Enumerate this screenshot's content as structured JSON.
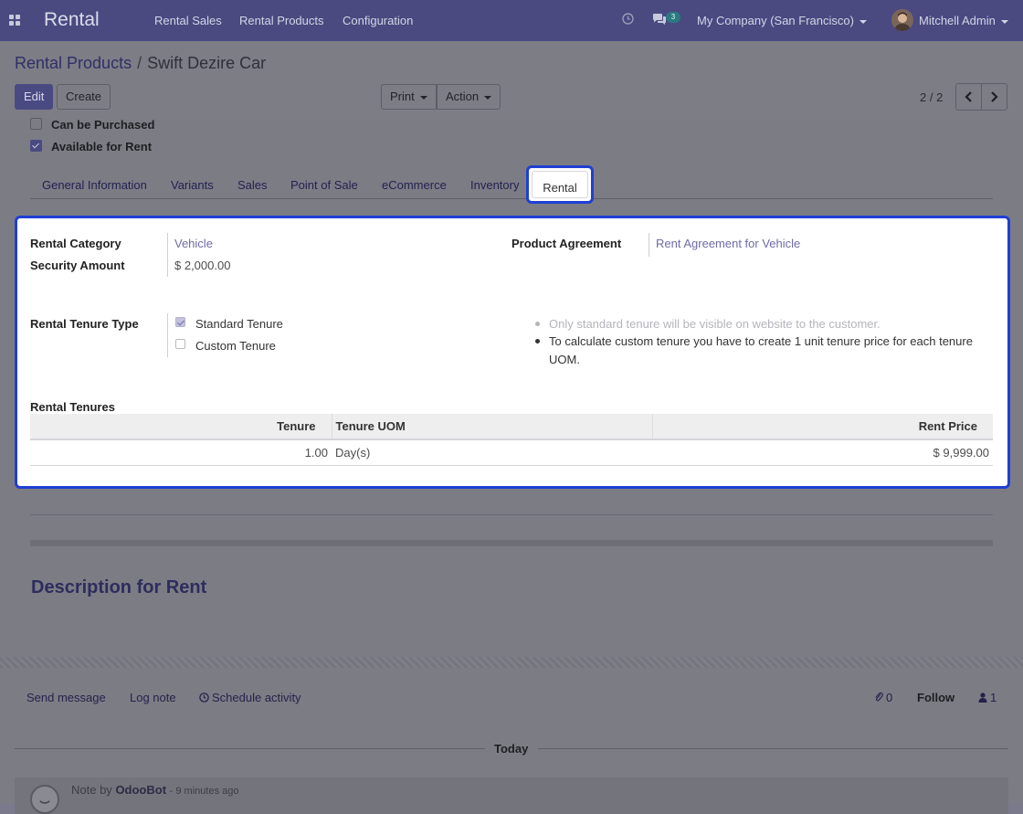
{
  "navbar": {
    "app_name": "Rental",
    "menu": [
      "Rental Sales",
      "Rental Products",
      "Configuration"
    ],
    "messages_count": "3",
    "company": "My Company (San Francisco)",
    "user": "Mitchell Admin"
  },
  "breadcrumb": {
    "parent": "Rental Products",
    "separator": "/",
    "current": "Swift Dezire Car"
  },
  "toolbar": {
    "edit_label": "Edit",
    "create_label": "Create",
    "print_label": "Print",
    "action_label": "Action"
  },
  "pager": {
    "value": "2 / 2"
  },
  "form": {
    "options": [
      {
        "label": "Can be Purchased",
        "checked": false
      },
      {
        "label": "Available for Rent",
        "checked": true
      }
    ],
    "tabs": [
      "General Information",
      "Variants",
      "Sales",
      "Point of Sale",
      "eCommerce",
      "Inventory",
      "Rental"
    ],
    "active_tab": "Rental",
    "rental": {
      "rental_category_label": "Rental Category",
      "rental_category_value": "Vehicle",
      "security_amount_label": "Security Amount",
      "security_amount_value": "$ 2,000.00",
      "product_agreement_label": "Product Agreement",
      "product_agreement_value": "Rent Agreement for Vehicle",
      "tenure_type_label": "Rental Tenure Type",
      "tenure_options": [
        {
          "label": "Standard Tenure",
          "checked": true
        },
        {
          "label": "Custom Tenure",
          "checked": false
        }
      ],
      "help": [
        "Only standard tenure will be visible on website to the customer.",
        "To calculate custom tenure you have to create 1 unit tenure price for each tenure",
        "UOM."
      ],
      "tenures_title": "Rental Tenures",
      "table": {
        "columns": [
          "Tenure",
          "Tenure UOM",
          "Rent Price"
        ],
        "rows": [
          [
            "1.00",
            "Day(s)",
            "$ 9,999.00"
          ]
        ]
      }
    },
    "description_title": "Description for Rent"
  },
  "chatter": {
    "send_message": "Send message",
    "log_note": "Log note",
    "schedule_activity": "Schedule activity",
    "attachments_count": "0",
    "follow_label": "Follow",
    "followers_count": "1",
    "today_label": "Today",
    "note_prefix": "Note by",
    "note_author": "OdooBot",
    "note_time": "- 9 minutes ago"
  },
  "colors": {
    "navbar": "#4a4a81",
    "highlight_border": "#1f3fd4",
    "link": "#6f6aa6"
  }
}
